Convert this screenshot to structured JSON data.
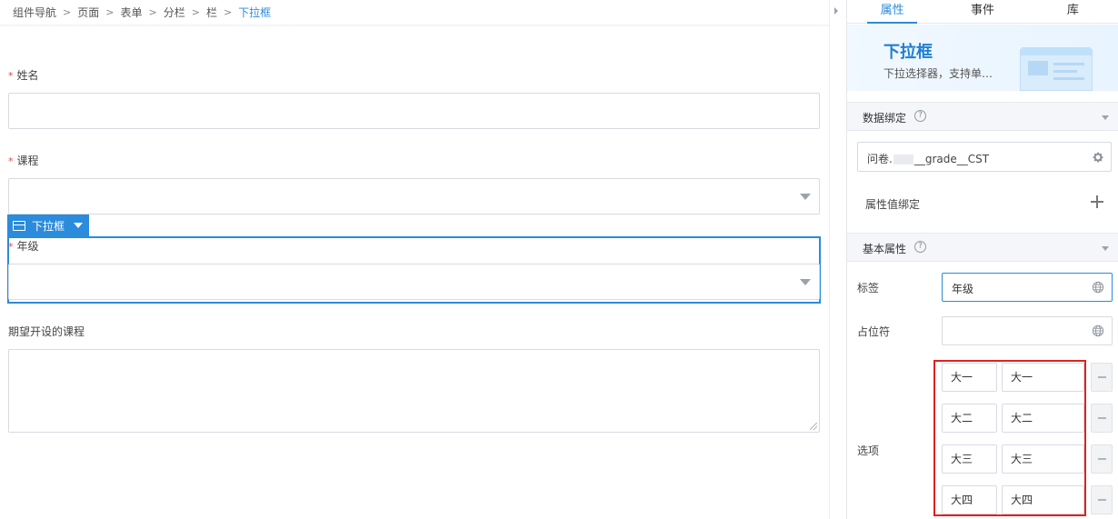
{
  "breadcrumb": {
    "items": [
      "组件导航",
      "页面",
      "表单",
      "分栏",
      "栏"
    ],
    "current": "下拉框"
  },
  "form": {
    "name_label": "姓名",
    "course_label": "课程",
    "grade_label": "年级",
    "expect_label": "期望开设的课程",
    "required_mark": "*"
  },
  "selected_component": {
    "tag_label": "下拉框"
  },
  "panel": {
    "tabs": [
      "属性",
      "事件",
      "库"
    ],
    "active_tab": "属性",
    "banner": {
      "title": "下拉框",
      "desc": "下拉选择器，支持单…"
    },
    "data_binding": {
      "title": "数据绑定",
      "value_prefix": "问卷.",
      "value_suffix": "__grade__CST",
      "attr_bind_label": "属性值绑定"
    },
    "basic": {
      "title": "基本属性",
      "label_label": "标签",
      "label_value": "年级",
      "placeholder_label": "占位符",
      "placeholder_value": "",
      "options_label": "选项",
      "options": [
        {
          "key": "大一",
          "value": "大一"
        },
        {
          "key": "大二",
          "value": "大二"
        },
        {
          "key": "大三",
          "value": "大三"
        },
        {
          "key": "大四",
          "value": "大四"
        }
      ]
    }
  },
  "colors": {
    "accent": "#2b8bdc",
    "required": "#e04a4a",
    "highlight": "#e02020"
  }
}
